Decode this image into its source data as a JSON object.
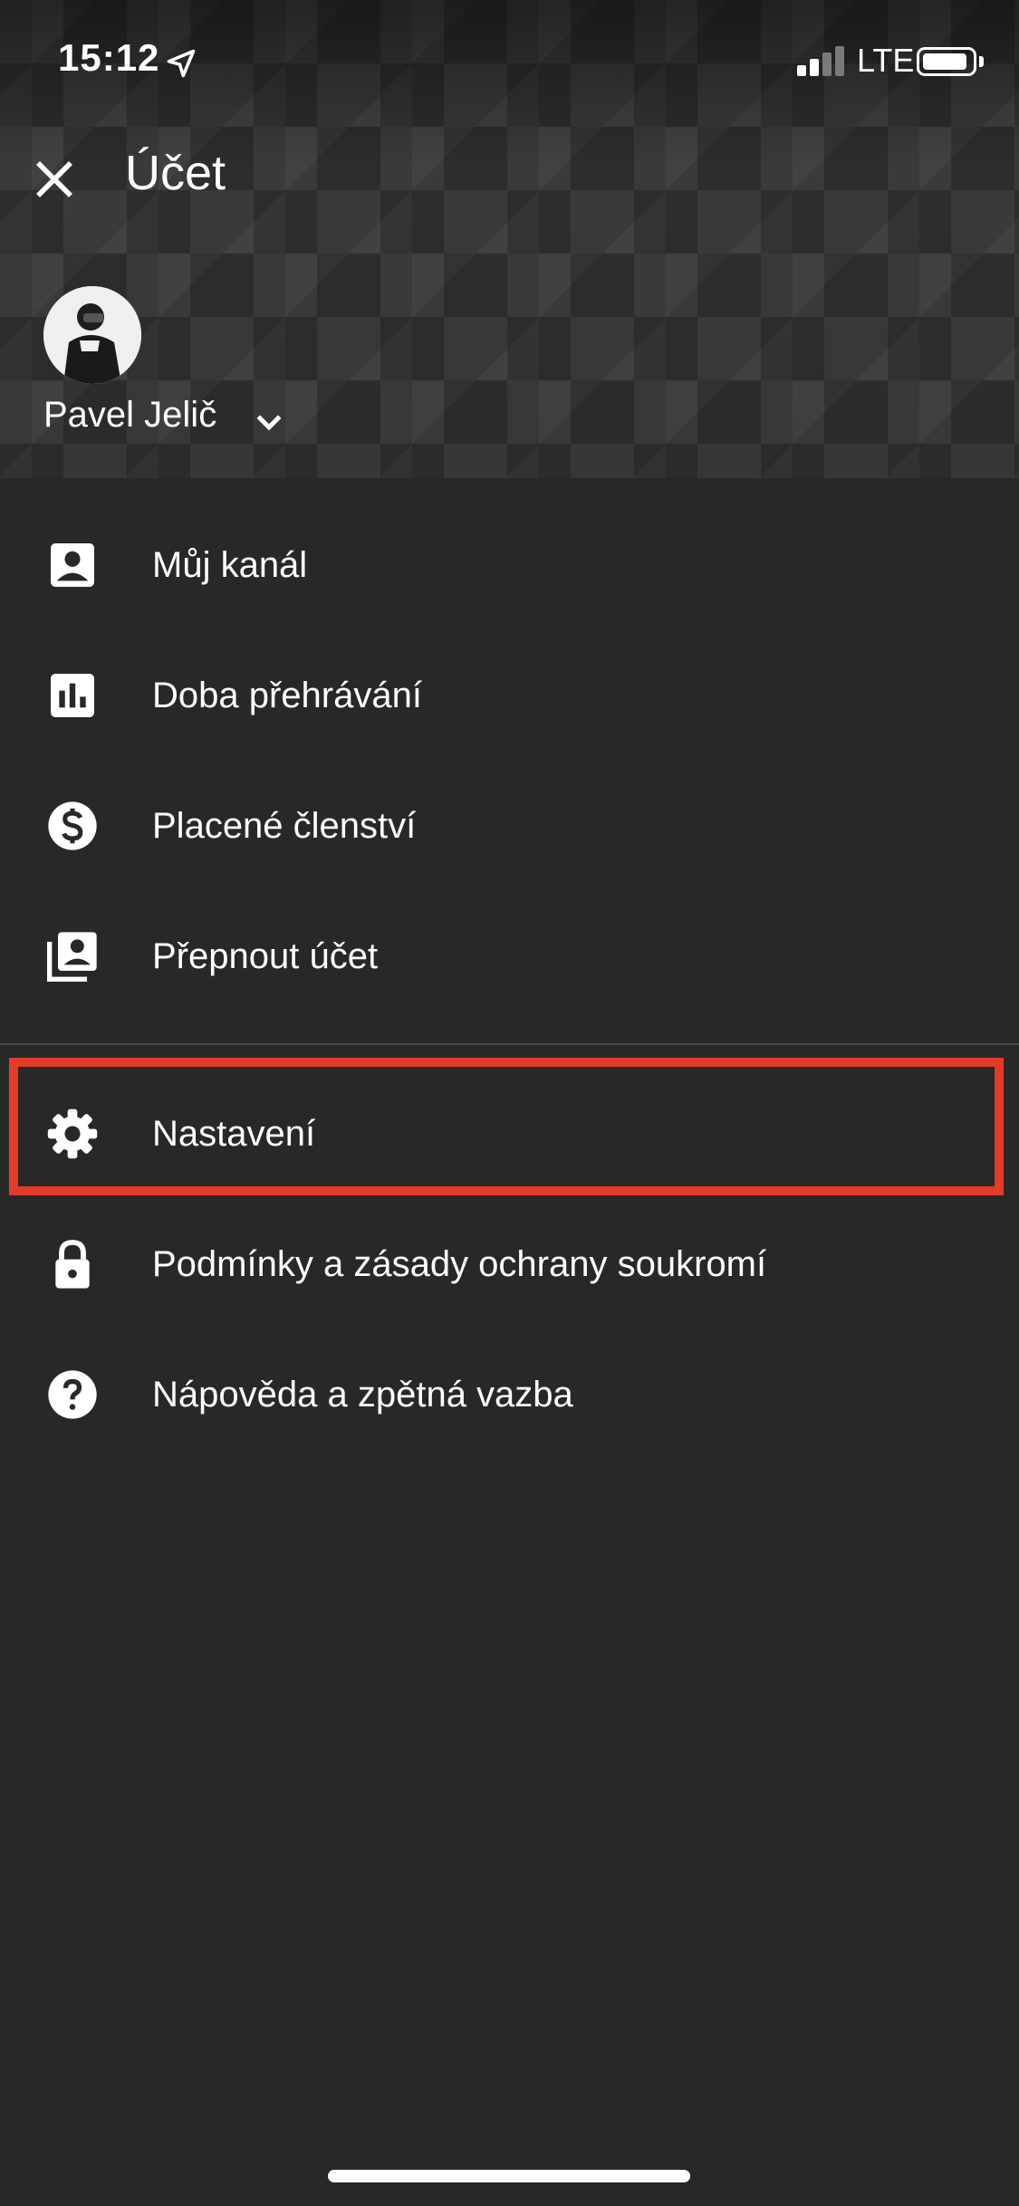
{
  "status_bar": {
    "time": "15:12",
    "network": "LTE",
    "signal_bars_active": 2,
    "signal_bars_total": 4,
    "battery_level": 0.85
  },
  "header": {
    "title": "Účet"
  },
  "account": {
    "name": "Pavel Jelič"
  },
  "menu": {
    "items": [
      {
        "label": "Můj kanál",
        "icon": "person-box-icon"
      },
      {
        "label": "Doba přehrávání",
        "icon": "bar-chart-icon"
      },
      {
        "label": "Placené členství",
        "icon": "dollar-circle-icon"
      },
      {
        "label": "Přepnout účet",
        "icon": "switch-account-icon"
      },
      {
        "label": "Nastavení",
        "icon": "gear-icon"
      },
      {
        "label": "Podmínky a zásady ochrany soukromí",
        "icon": "lock-icon"
      },
      {
        "label": "Nápověda a zpětná vazba",
        "icon": "help-circle-icon"
      }
    ]
  },
  "colors": {
    "background": "#282828",
    "highlight": "#e53a2a",
    "text": "#ffffff"
  }
}
